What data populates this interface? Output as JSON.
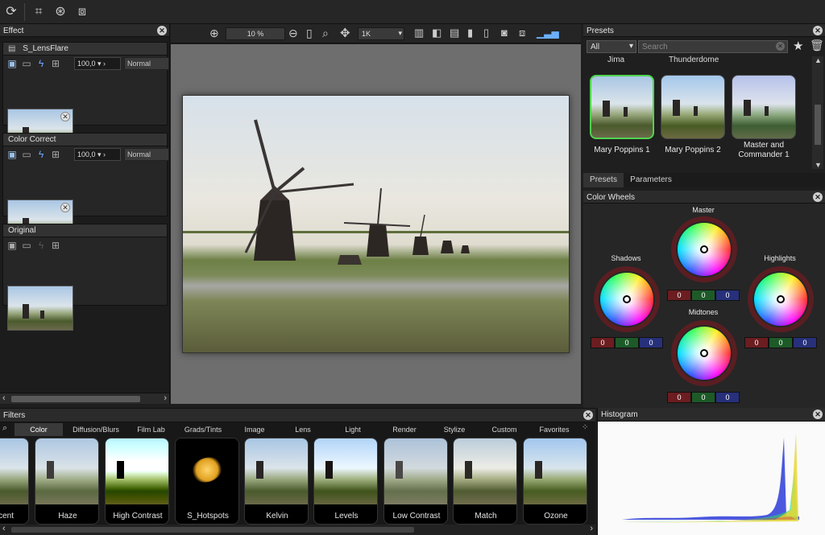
{
  "toolbar_top": {
    "icons": [
      "refresh-icon",
      "crop-icon",
      "transform-icon",
      "fit-icon"
    ]
  },
  "effect_panel": {
    "title": "Effect",
    "layers": [
      {
        "name": "S_LensFlare",
        "opacity": "100,0",
        "blend": "Normal"
      },
      {
        "name": "Color Correct",
        "opacity": "100,0",
        "blend": "Normal"
      },
      {
        "name": "Original"
      }
    ]
  },
  "canvas_toolbar": {
    "zoom": "10 %",
    "preview_size": "1K"
  },
  "presets_panel": {
    "title": "Presets",
    "category": "All",
    "search_placeholder": "Search",
    "partial_labels": [
      "Jima",
      "Thunderdome"
    ],
    "items": [
      {
        "label_line1": "Mary Poppins 1",
        "label_line2": ""
      },
      {
        "label_line1": "Mary Poppins 2",
        "label_line2": ""
      },
      {
        "label_line1": "Master and",
        "label_line2": "Commander 1"
      }
    ],
    "tabs": [
      "Presets",
      "Parameters"
    ]
  },
  "color_wheels": {
    "title": "Color Wheels",
    "wheels": [
      {
        "name": "Master",
        "r": "0",
        "g": "0",
        "b": "0"
      },
      {
        "name": "Shadows",
        "r": "0",
        "g": "0",
        "b": "0"
      },
      {
        "name": "Highlights",
        "r": "0",
        "g": "0",
        "b": "0"
      },
      {
        "name": "Midtones",
        "r": "0",
        "g": "0",
        "b": "0"
      }
    ],
    "colors": {
      "r": "#6b1d20",
      "g": "#1d5a28",
      "b": "#27307a"
    }
  },
  "filters_panel": {
    "title": "Filters",
    "tabs": [
      "Color",
      "Diffusion/Blurs",
      "Film Lab",
      "Grads/Tints",
      "Image",
      "Lens",
      "Light",
      "Render",
      "Stylize",
      "Custom",
      "Favorites"
    ],
    "active_tab": "Color",
    "items": [
      "scent",
      "Haze",
      "High Contrast",
      "S_Hotspots",
      "Kelvin",
      "Levels",
      "Low Contrast",
      "Match",
      "Ozone"
    ]
  },
  "histogram_panel": {
    "title": "Histogram"
  }
}
